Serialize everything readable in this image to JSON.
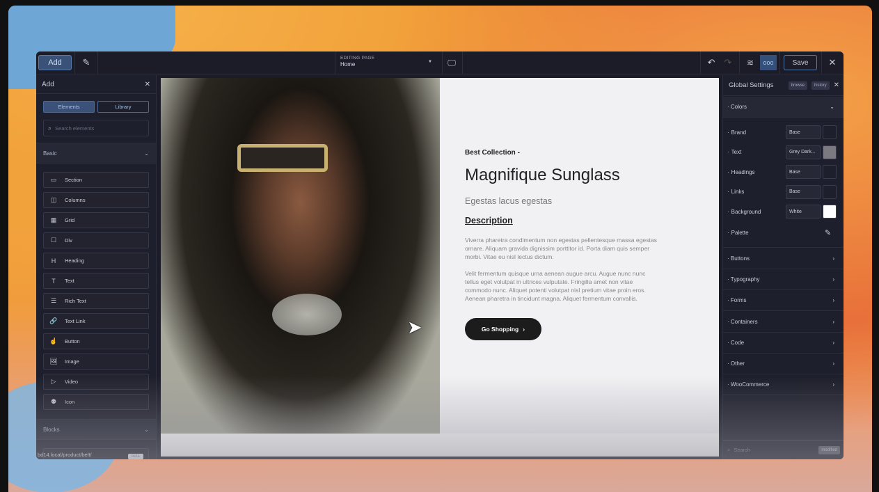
{
  "toolbar": {
    "add_label": "Add",
    "editing_page_label": "EDITING PAGE",
    "editing_page_value": "Home",
    "save_label": "Save"
  },
  "left_panel": {
    "title": "Add",
    "tabs": [
      "Elements",
      "Library"
    ],
    "search_placeholder": "Search elements",
    "basic_label": "Basic",
    "blocks_label": "Blocks",
    "items": [
      {
        "label": "Section",
        "icon": "▭"
      },
      {
        "label": "Columns",
        "icon": "◫"
      },
      {
        "label": "Grid",
        "icon": "▦"
      },
      {
        "label": "Div",
        "icon": "☐"
      },
      {
        "label": "Heading",
        "icon": "H"
      },
      {
        "label": "Text",
        "icon": "T"
      },
      {
        "label": "Rich Text",
        "icon": "☰"
      },
      {
        "label": "Text Link",
        "icon": "🔗"
      },
      {
        "label": "Button",
        "icon": "☝"
      },
      {
        "label": "Image",
        "icon": "🖼"
      },
      {
        "label": "Video",
        "icon": "▷"
      },
      {
        "label": "Icon",
        "icon": "⚉"
      }
    ],
    "url": "bd14.local/product/belt/",
    "beta": "beta"
  },
  "canvas": {
    "eyebrow": "Best Collection -",
    "title": "Magnifique Sunglass",
    "subtitle": "Egestas lacus egestas",
    "desc_heading": "Description",
    "para1": "Viverra pharetra condimentum non egestas pellentesque massa egestas ornare. Aliquam gravida dignissim porttitor id. Porta diam quis semper morbi. Vitae eu nisl lectus dictum.",
    "para2": "Velit fermentum quisque urna aenean augue arcu. Augue nunc nunc tellus eget volutpat in ultrices vulputate. Fringilla amet non vitae commodo nunc. Aliquet potenti volutpat nisl pretium vitae proin eros. Aenean pharetra in tincidunt magna. Aliquet fermentum convallis.",
    "cta": "Go Shopping"
  },
  "right_panel": {
    "title": "Global Settings",
    "browse": "browse",
    "history": "history",
    "colors_label": "Colors",
    "colors": [
      {
        "label": "Brand",
        "value": "Base",
        "swatch": "#1e1f2c"
      },
      {
        "label": "Text",
        "value": "Grey Dark...",
        "swatch": "#7a7a80"
      },
      {
        "label": "Headings",
        "value": "Base",
        "swatch": "#1e1f2c"
      },
      {
        "label": "Links",
        "value": "Base",
        "swatch": "#1e1f2c"
      },
      {
        "label": "Background",
        "value": "White",
        "swatch": "#ffffff"
      }
    ],
    "palette_label": "Palette",
    "groups": [
      "Buttons",
      "Typography",
      "Forms",
      "Containers",
      "Code",
      "Other",
      "WooCommerce"
    ],
    "search_placeholder": "Search",
    "modified": "modified"
  }
}
